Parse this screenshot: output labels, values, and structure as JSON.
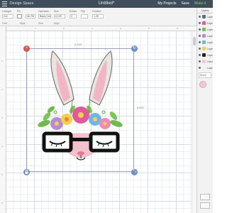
{
  "app": {
    "name": "Design Space",
    "doc_title": "Untitled*"
  },
  "header": {
    "my_projects": "My Projects",
    "save": "Save",
    "make": "Make it"
  },
  "toolbar": [
    {
      "label": "Linetype",
      "value": "Cut"
    },
    {
      "label": "Fill",
      "value": "No Fill"
    },
    {
      "label": "Operation",
      "value": "Basic Cut"
    },
    {
      "label": "Size",
      "value": "6.129"
    },
    {
      "label": "Rotate",
      "value": "0"
    },
    {
      "label": "Flip",
      "value": ""
    },
    {
      "label": "Position",
      "value": "1.25"
    }
  ],
  "toolbar_lower": {
    "font": "Font",
    "style": "Style",
    "size": "Size",
    "align": "Align"
  },
  "ruler": {
    "top": [
      "1",
      "2",
      "3",
      "4",
      "5",
      "6"
    ],
    "left": [
      "1",
      "2",
      "3",
      "4",
      "5",
      "6"
    ]
  },
  "selection": {
    "width_label": "6.129\"",
    "height_label": "6.993\""
  },
  "handles": {
    "delete": "×",
    "rotate": "↻",
    "lock": "🔒",
    "size": "⤡"
  },
  "layers_panel": {
    "tabs": [
      "Layers",
      "Color"
    ],
    "rows": [
      {
        "label": "Layer",
        "color": "#5a6e8a"
      },
      {
        "label": "Layer",
        "color": "#e2589c"
      },
      {
        "label": "Layer",
        "color": "#72c25b"
      },
      {
        "label": "Layer",
        "color": "#b48ad8"
      },
      {
        "label": "Layer",
        "color": "#6fb6e8"
      },
      {
        "label": "Layer",
        "color": "#f5d14a"
      },
      {
        "label": "Layer",
        "color": "#222222"
      },
      {
        "label": "Llama",
        "color": "#f6c8d2"
      },
      {
        "label": "Layer",
        "color": "#f0f0f0"
      }
    ],
    "search_placeholder": "Blank",
    "canvas_color": "#f4c7d1"
  },
  "colors": {
    "topbar": "#3f4e5a",
    "accent": "#7fdb6b",
    "selection": "#93a4bb",
    "delete": "#d9534f",
    "handle": "#6f90c4"
  },
  "icons": {
    "menu": "hamburger-icon",
    "delete": "close-icon",
    "rotate": "rotate-icon",
    "lock": "lock-icon",
    "size": "resize-icon"
  }
}
